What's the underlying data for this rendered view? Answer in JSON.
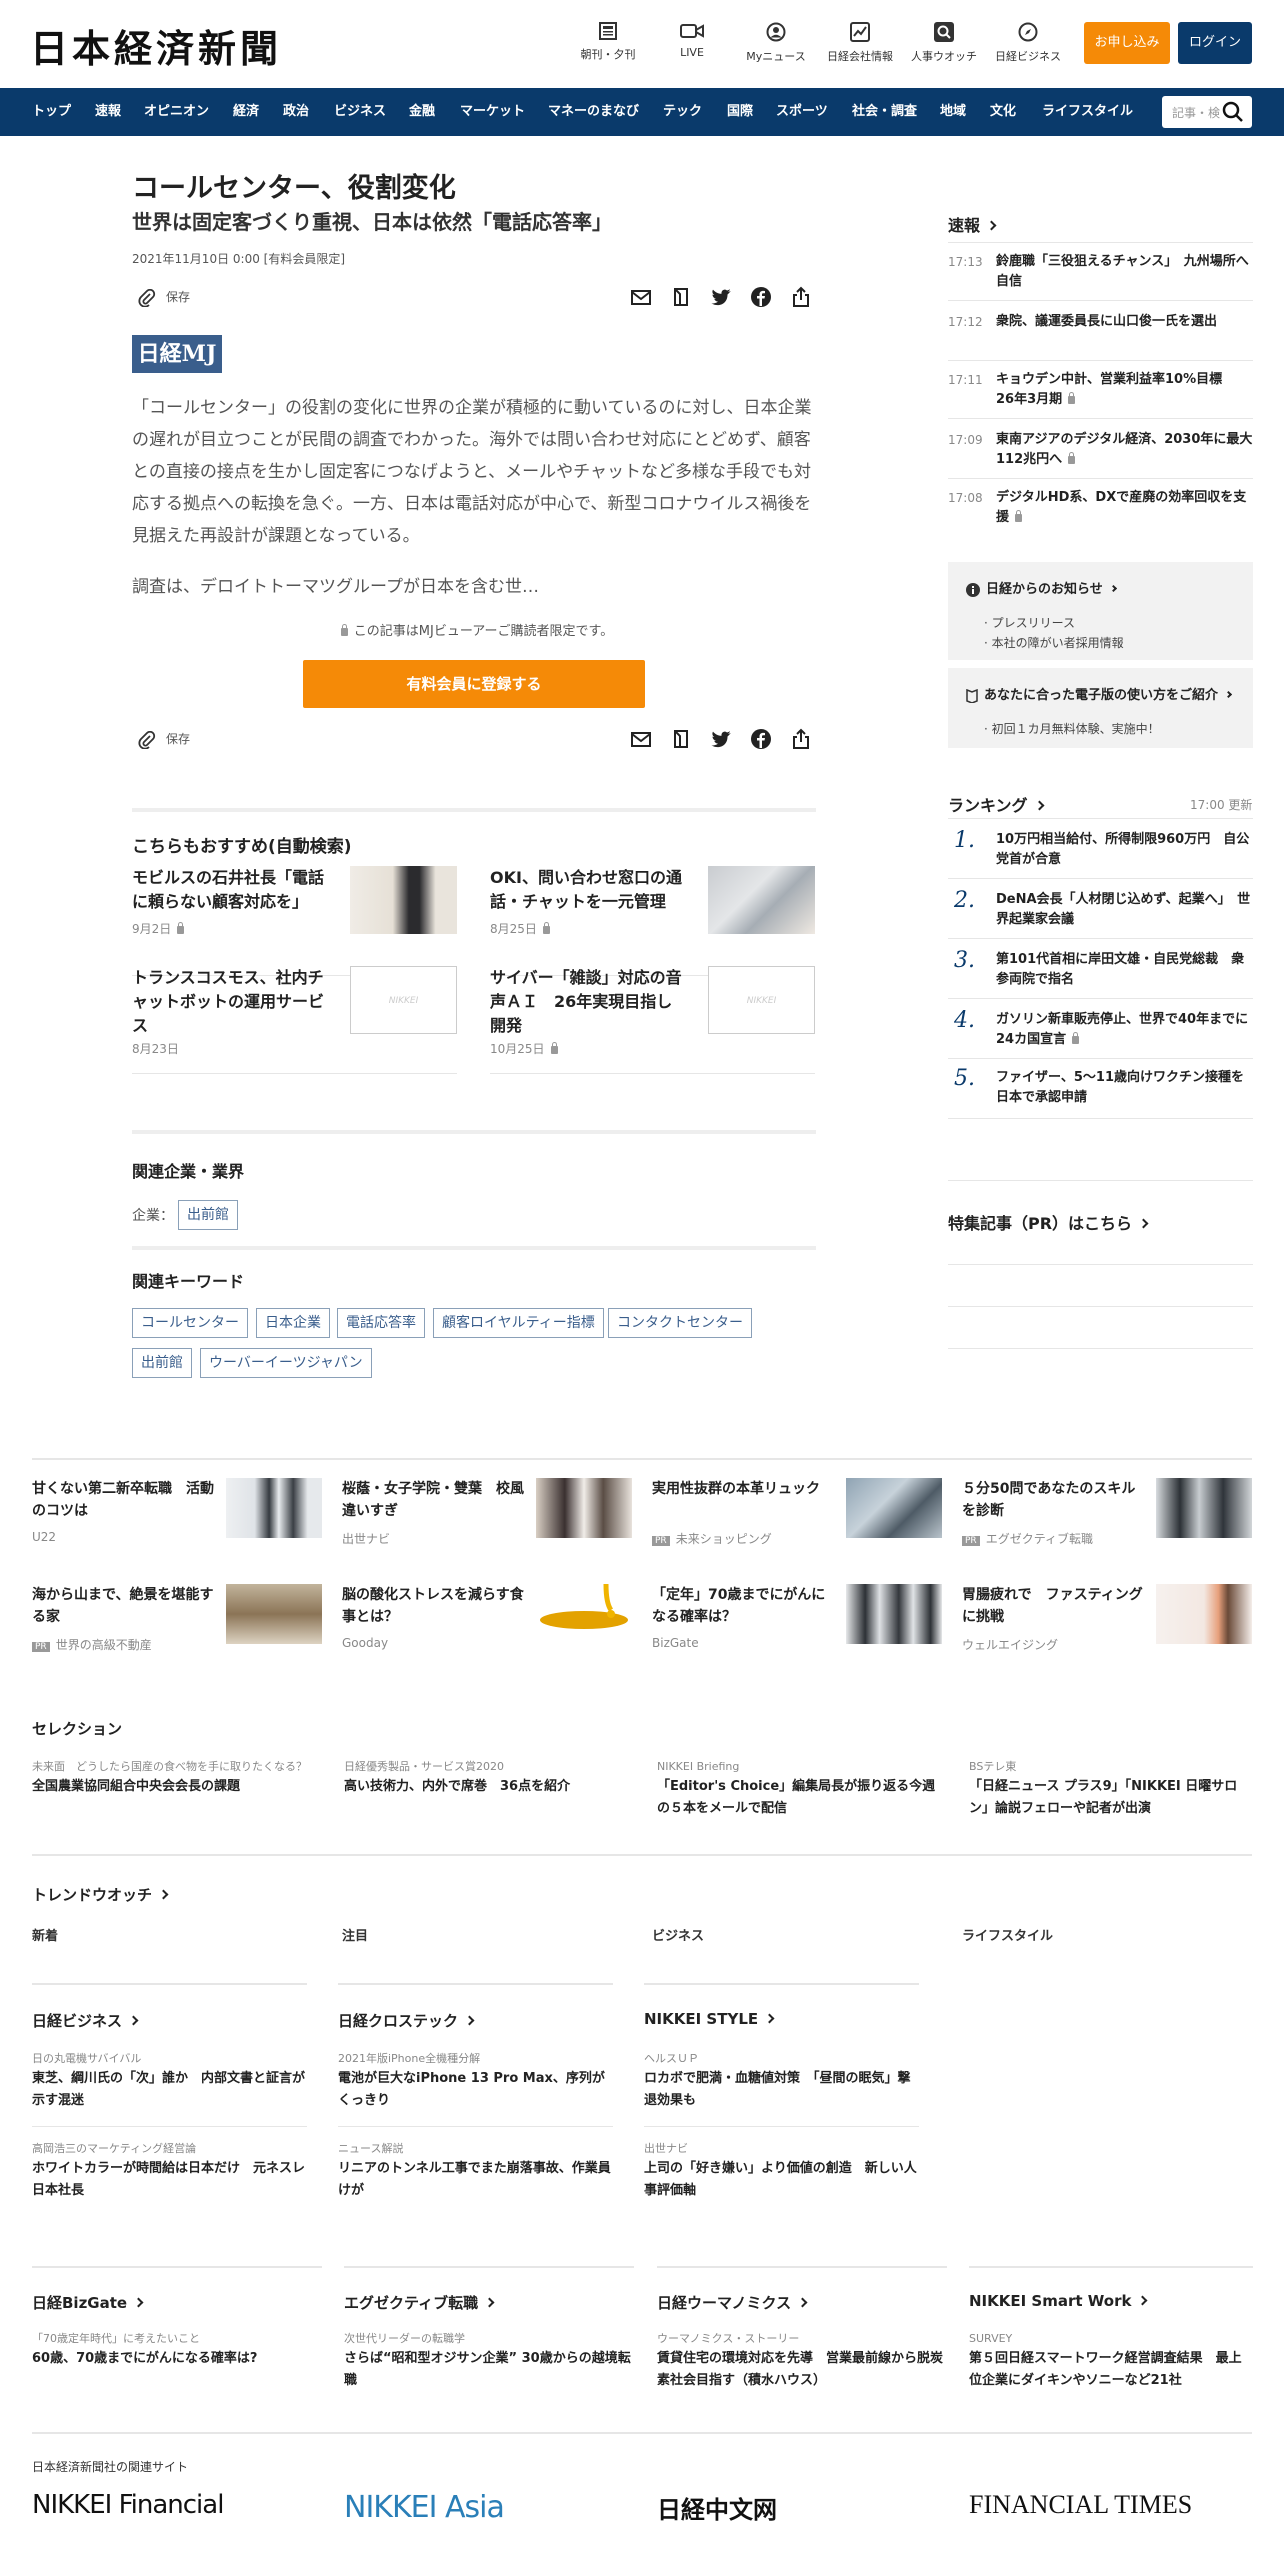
{
  "header": {
    "logo": "日本経済新聞",
    "icons": [
      {
        "name": "paper-icon",
        "label": "朝刊・夕刊"
      },
      {
        "name": "video-icon",
        "label": "LIVE"
      },
      {
        "name": "user-icon",
        "label": "Myニュース"
      },
      {
        "name": "chart-icon",
        "label": "日経会社情報"
      },
      {
        "name": "search-person-icon",
        "label": "人事ウオッチ"
      },
      {
        "name": "compass-icon",
        "label": "日経ビジネス"
      }
    ],
    "apply": "お申し込み",
    "login": "ログイン"
  },
  "nav": {
    "items": [
      "トップ",
      "速報",
      "オピニオン",
      "経済",
      "政治",
      "ビジネス",
      "金融",
      "マーケット",
      "マネーのまなび",
      "テック",
      "国際",
      "スポーツ",
      "社会・調査",
      "地域",
      "文化",
      "ライフスタイル"
    ],
    "search_placeholder": "記事・検"
  },
  "article": {
    "title": "コールセンター、役割変化",
    "subtitle": "世界は固定客づくり重視、日本は依然「電話応答率」",
    "date": "2021年11月10日 0:00 [有料会員限定]",
    "save": "保存",
    "badge": "日経MJ",
    "lead": "「コールセンター」の役割の変化に世界の企業が積極的に動いているのに対し、日本企業の遅れが目立つことが民間の調査でわかった。海外では問い合わせ対応にとどめず、顧客との直接の接点を生かし固定客につなげようと、メールやチャットなど多様な手段でも対応する拠点への転換を急ぐ。一方、日本は電話対応が中心で、新型コロナウイルス禍後を見据えた再設計が課題となっている。",
    "lead2": "調査は、デロイトトーマツグループが日本を含む世…",
    "paywall": "この記事はMJビューアーご購読者限定です。",
    "register": "有料会員に登録する"
  },
  "recommend": {
    "title": "こちらもおすすめ(自動検索)",
    "items": [
      {
        "title": "モビルスの石井社長「電話に頼らない顧客対応を」",
        "date": "9月2日"
      },
      {
        "title": "OKI、問い合わせ窓口の通話・チャットを一元管理",
        "date": "8月25日"
      },
      {
        "title": "トランスコスモス、社内チャットボットの運用サービス",
        "date": "8月23日"
      },
      {
        "title": "サイバー「雑談」対応の音声ＡＩ　26年実現目指し開発",
        "date": "10月25日"
      }
    ]
  },
  "related": {
    "title": "関連企業・業界",
    "label": "企業：",
    "companies": [
      "出前館"
    ]
  },
  "keywords": {
    "title": "関連キーワード",
    "items": [
      "コールセンター",
      "日本企業",
      "電話応答率",
      "顧客ロイヤルティー指標",
      "コンタクトセンター",
      "出前館",
      "ウーバーイーツジャパン"
    ]
  },
  "sidebar": {
    "flash_title": "速報",
    "flash": [
      {
        "time": "17:13",
        "text": "鈴鹿職「三役狙えるチャンス」　九州場所へ自信"
      },
      {
        "time": "17:12",
        "text": "衆院、議運委員長に山口俊一氏を選出"
      },
      {
        "time": "17:11",
        "text": "キョウデン中計、営業利益率10%目標　26年3月期"
      },
      {
        "time": "17:09",
        "text": "東南アジアのデジタル経済、2030年に最大112兆円へ"
      },
      {
        "time": "17:08",
        "text": "デジタルHD系、DXで産廃の効率回収を支援"
      }
    ],
    "notice1": {
      "title": "日経からのお知らせ",
      "items": [
        "プレスリリース",
        "本社の障がい者採用情報"
      ]
    },
    "notice2": {
      "title": "あなたに合った電子版の使い方をご紹介",
      "items": [
        "初回１カ月無料体験、実施中！"
      ]
    },
    "ranking_title": "ランキング",
    "ranking_time": "17:00",
    "ranking_update": "更新",
    "ranking": [
      {
        "rank": "1.",
        "text": "10万円相当給付、所得制限960万円　自公党首が合意"
      },
      {
        "rank": "2.",
        "text": "DeNA会長「人材閉じ込めず、起業へ」　世界起業家会議"
      },
      {
        "rank": "3.",
        "text": "第101代首相に岸田文雄・自民党総裁　衆参両院で指名"
      },
      {
        "rank": "4.",
        "text": "ガソリン新車販売停止、世界で40年までに24カ国宣言"
      },
      {
        "rank": "5.",
        "text": "ファイザー、5～11歳向けワクチン接種を日本で承認申請"
      }
    ],
    "pr": "特集記事（PR）はこちら"
  },
  "ads": [
    {
      "title": "甘くない第二新卒転職　活動のコツは",
      "source": "U22",
      "pr": false
    },
    {
      "title": "桜蔭・女子学院・雙葉　校風違いすぎ",
      "source": "出世ナビ",
      "pr": false
    },
    {
      "title": "実用性抜群の本革リュック",
      "source": "未来ショッピング",
      "pr": true
    },
    {
      "title": "５分50問であなたのスキルを診断",
      "source": "エグゼクティブ転職",
      "pr": true
    },
    {
      "title": "海から山まで、絶景を堪能する家",
      "source": "世界の高級不動産",
      "pr": true
    },
    {
      "title": "脳の酸化ストレスを減らす食事とは？",
      "source": "Gooday",
      "pr": false
    },
    {
      "title": "「定年」70歳までにがんになる確率は？",
      "source": "BizGate",
      "pr": false
    },
    {
      "title": "胃腸疲れで　ファスティングに挑戦",
      "source": "ウェルエイジング",
      "pr": false
    }
  ],
  "selection": {
    "title": "セレクション",
    "items": [
      {
        "cat": "未来面　どうしたら国産の食べ物を手に取りたくなる？",
        "title": "全国農業協同組合中央会会長の課題"
      },
      {
        "cat": "日経優秀製品・サービス賞2020",
        "title": "高い技術力、内外で席巻　36点を紹介"
      },
      {
        "cat": "NIKKEI Briefing",
        "title": "「Editor's Choice」編集局長が振り返る今週の５本をメールで配信"
      },
      {
        "cat": "BSテレ東",
        "title": "「日経ニュース プラス9」「NIKKEI 日曜サロン」論説フェローや記者が出演"
      }
    ]
  },
  "trend": {
    "title": "トレンドウオッチ",
    "cats": [
      "新着",
      "注目",
      "ビジネス",
      "ライフスタイル"
    ]
  },
  "sites1": [
    {
      "title": "日経ビジネス",
      "items": [
        {
          "cat": "日の丸電機サバイバル",
          "title": "東芝、綱川氏の「次」誰か　内部文書と証言が示す混迷"
        },
        {
          "cat": "高岡浩三のマーケティング経営論",
          "title": "ホワイトカラーが時間給は日本だけ　元ネスレ日本社長"
        }
      ]
    },
    {
      "title": "日経クロステック",
      "items": [
        {
          "cat": "2021年版iPhone全機種分解",
          "title": "電池が巨大なiPhone 13 Pro Max、序列がくっきり"
        },
        {
          "cat": "ニュース解説",
          "title": "リニアのトンネル工事でまた崩落事故、作業員けが"
        }
      ]
    },
    {
      "title": "NIKKEI STYLE",
      "items": [
        {
          "cat": "ヘルスＵＰ",
          "title": "ロカボで肥満・血糖値対策　「昼間の眠気」撃退効果も"
        },
        {
          "cat": "出世ナビ",
          "title": "上司の「好き嫌い」より価値の創造　新しい人事評価軸"
        }
      ]
    }
  ],
  "sites2": [
    {
      "title": "日経BizGate",
      "cat": "「70歳定年時代」に考えたいこと",
      "text": "60歳、70歳までにがんになる確率は?"
    },
    {
      "title": "エグゼクティブ転職",
      "cat": "次世代リーダーの転職学",
      "text": "さらば“昭和型オジサン企業” 30歳からの越境転職"
    },
    {
      "title": "日経ウーマノミクス",
      "cat": "ウーマノミクス・ストーリー",
      "text": "賃貸住宅の環境対応を先導　営業最前線から脱炭素社会目指す（積水ハウス）"
    },
    {
      "title": "NIKKEI Smart Work",
      "cat": "SURVEY",
      "text": "第５回日経スマートワーク経営調査結果　最上位企業にダイキンやソニーなど21社"
    }
  ],
  "related_sites": {
    "title": "日本経済新聞社の関連サイト",
    "brands": [
      "NIKKEI Financial",
      "NIKKEI Asia",
      "日経中文网",
      "FINANCIAL TIMES"
    ]
  }
}
